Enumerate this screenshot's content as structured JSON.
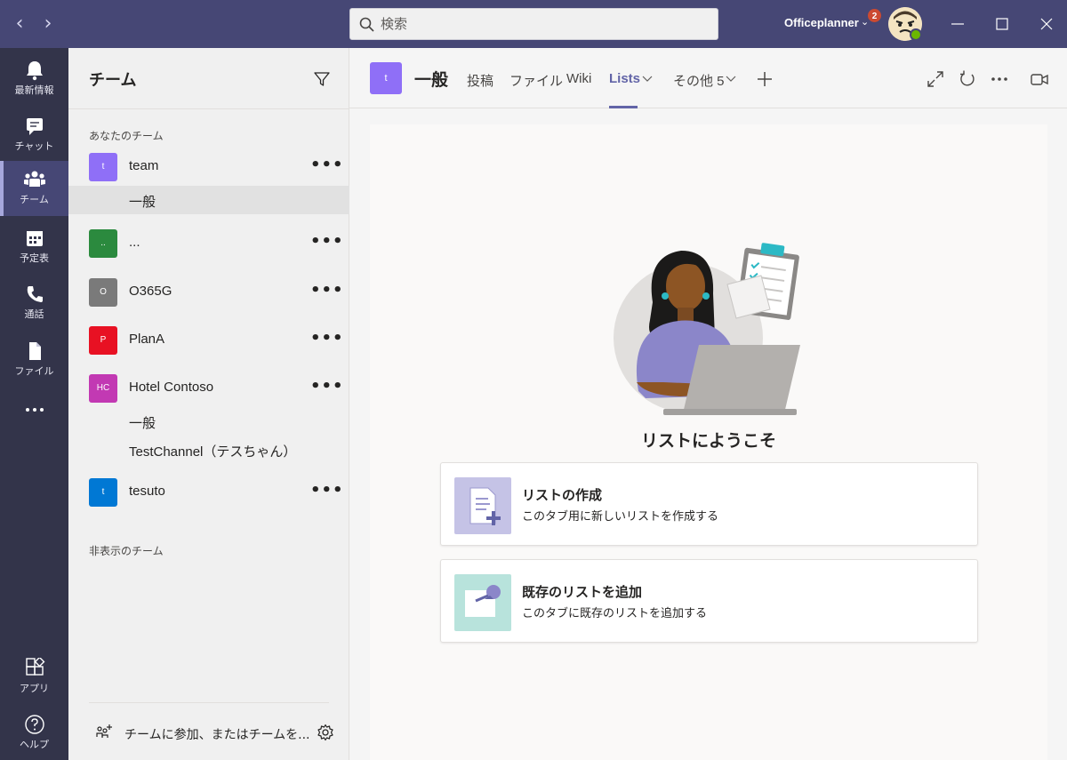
{
  "titlebar": {
    "search_placeholder": "検索",
    "account_name": "Officeplanner",
    "notification_count": "2"
  },
  "rail": {
    "items": [
      {
        "label": "最新情報",
        "icon": "bell-icon"
      },
      {
        "label": "チャット",
        "icon": "chat-icon"
      },
      {
        "label": "チーム",
        "icon": "teams-icon"
      },
      {
        "label": "予定表",
        "icon": "calendar-icon"
      },
      {
        "label": "通話",
        "icon": "phone-icon"
      },
      {
        "label": "ファイル",
        "icon": "file-icon"
      },
      {
        "label": "",
        "icon": "more-icon"
      },
      {
        "label": "アプリ",
        "icon": "apps-icon"
      },
      {
        "label": "ヘルプ",
        "icon": "help-icon"
      }
    ]
  },
  "panel": {
    "title": "チーム",
    "your_teams_label": "あなたのチーム",
    "hidden_teams_label": "非表示のチーム",
    "join_label": "チームに参加、またはチームを...",
    "teams": [
      {
        "initials": "t",
        "name": "team",
        "color": "#8f6ff7",
        "channels": [
          "一般"
        ]
      },
      {
        "initials": "..",
        "name": "...",
        "color": "#2b8a3e"
      },
      {
        "initials": "O",
        "name": "O365G",
        "color": "#7a7a7a"
      },
      {
        "initials": "P",
        "name": "PlanA",
        "color": "#e81123"
      },
      {
        "initials": "HC",
        "name": "Hotel Contoso",
        "color": "#c239b3",
        "channels": [
          "一般",
          "TestChannel（テスちゃん）"
        ]
      },
      {
        "initials": "t",
        "name": "tesuto",
        "color": "#0078d4"
      }
    ],
    "more_label": "•••"
  },
  "channel_header": {
    "tile_initial": "t",
    "title": "一般",
    "tabs": [
      "投稿",
      "ファイル",
      "Wiki",
      "Lists",
      "その他 5"
    ],
    "active_tab": "Lists"
  },
  "main": {
    "welcome_title": "リストにようこそ",
    "cards": [
      {
        "title": "リストの作成",
        "description": "このタブ用に新しいリストを作成する"
      },
      {
        "title": "既存のリストを追加",
        "description": "このタブに既存のリストを追加する"
      }
    ]
  }
}
